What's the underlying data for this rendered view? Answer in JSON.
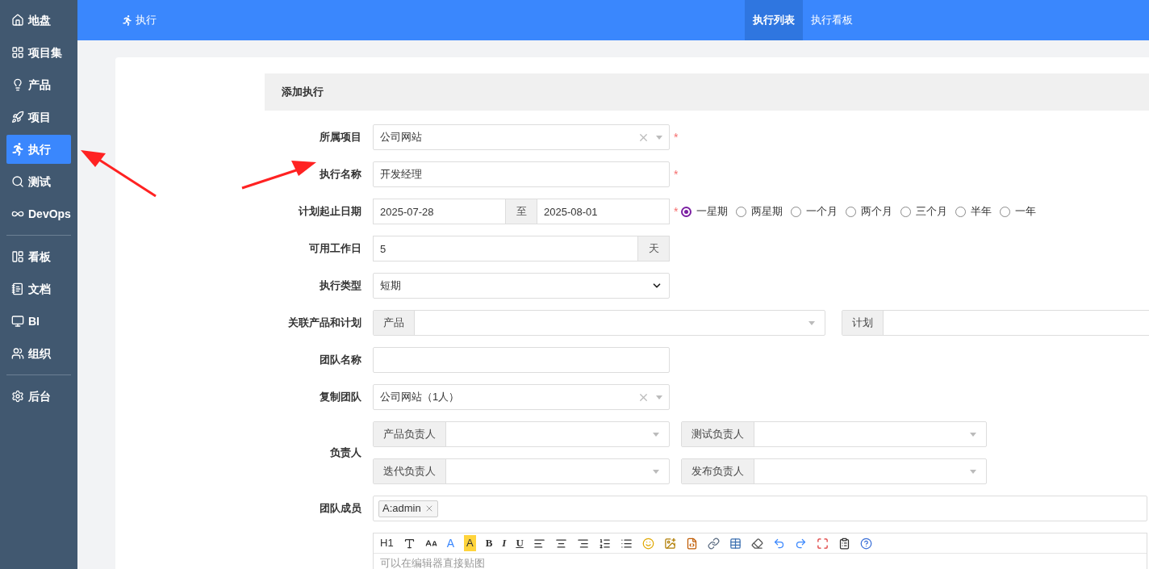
{
  "sidebar": {
    "groups": [
      [
        {
          "label": "地盘",
          "selected": false
        },
        {
          "label": "项目集",
          "selected": false
        },
        {
          "label": "产品",
          "selected": false
        },
        {
          "label": "项目",
          "selected": false
        },
        {
          "label": "执行",
          "selected": true
        },
        {
          "label": "测试",
          "selected": false
        },
        {
          "label": "DevOps",
          "selected": false
        }
      ],
      [
        {
          "label": "看板",
          "selected": false
        },
        {
          "label": "文档",
          "selected": false
        },
        {
          "label": "BI",
          "selected": false
        },
        {
          "label": "组织",
          "selected": false
        }
      ],
      [
        {
          "label": "后台",
          "selected": false
        }
      ]
    ]
  },
  "topbar": {
    "title": "执行",
    "tabs": [
      {
        "label": "执行列表",
        "selected": true
      },
      {
        "label": "执行看板",
        "selected": false
      }
    ]
  },
  "form": {
    "title": "添加执行",
    "project": {
      "label": "所属项目",
      "value": "公司网站",
      "required_mark": "*"
    },
    "name": {
      "label": "执行名称",
      "value": "开发经理",
      "required_mark": "*"
    },
    "dates": {
      "label": "计划起止日期",
      "start": "2025-07-28",
      "separator": "至",
      "end": "2025-08-01",
      "required_mark": "*",
      "periods": [
        {
          "label": "一星期",
          "selected": true
        },
        {
          "label": "两星期",
          "selected": false
        },
        {
          "label": "一个月",
          "selected": false
        },
        {
          "label": "两个月",
          "selected": false
        },
        {
          "label": "三个月",
          "selected": false
        },
        {
          "label": "半年",
          "selected": false
        },
        {
          "label": "一年",
          "selected": false
        }
      ]
    },
    "workdays": {
      "label": "可用工作日",
      "value": "5",
      "unit": "天"
    },
    "type": {
      "label": "执行类型",
      "value": "短期"
    },
    "links": {
      "label": "关联产品和计划",
      "product": "产品",
      "plan": "计划"
    },
    "team_name": {
      "label": "团队名称"
    },
    "copy_team": {
      "label": "复制团队",
      "value": "公司网站（1人）"
    },
    "owners": {
      "label": "负责人",
      "fields": [
        {
          "label": "产品负责人"
        },
        {
          "label": "测试负责人"
        },
        {
          "label": "迭代负责人"
        },
        {
          "label": "发布负责人"
        }
      ]
    },
    "members": {
      "label": "团队成员",
      "tags": [
        "A:admin"
      ]
    },
    "editor": {
      "toolbar": {
        "heading": "H1",
        "font_color": "A",
        "highlight": "A",
        "bold": "B",
        "italic": "I",
        "underline": "U"
      },
      "placeholder": "可以在编辑器直接贴图"
    }
  }
}
